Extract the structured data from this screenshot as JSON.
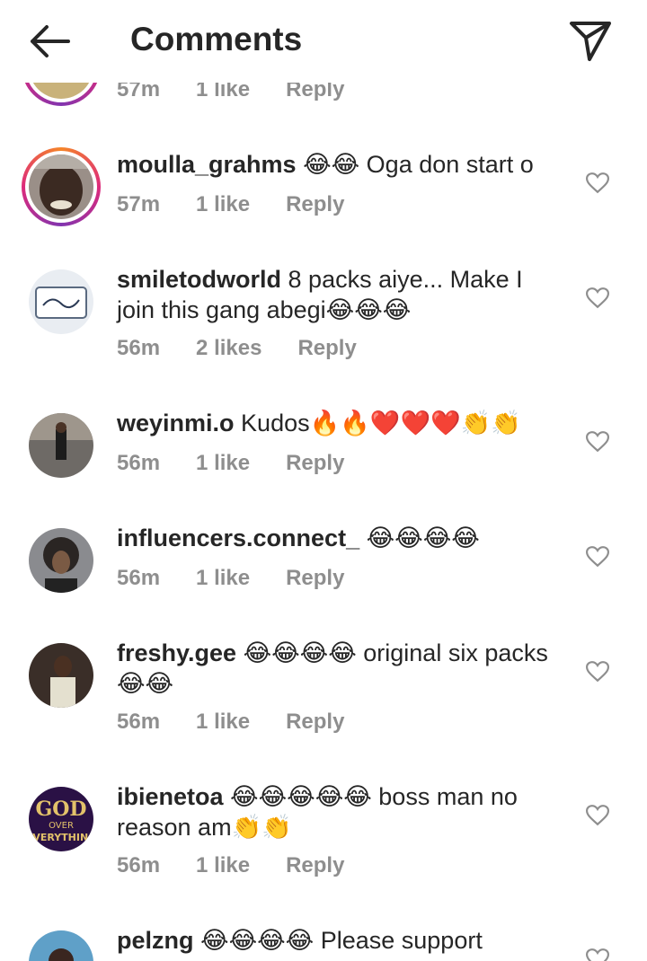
{
  "header": {
    "title": "Comments",
    "back_icon": "arrow-left-icon",
    "send_icon": "paper-plane-icon"
  },
  "partial_top": {
    "time": "57m",
    "likes": "1 like",
    "reply": "Reply"
  },
  "comments": [
    {
      "username": "moulla_grahms",
      "text": "😂😂 Oga don start o",
      "time": "57m",
      "likes": "1 like",
      "reply": "Reply"
    },
    {
      "username": "smiletodworld",
      "text": "8 packs aiye... Make I join this gang abegi😂😂😂",
      "time": "56m",
      "likes": "2 likes",
      "reply": "Reply"
    },
    {
      "username": "weyinmi.o",
      "text": "Kudos🔥🔥❤️❤️❤️👏👏",
      "time": "56m",
      "likes": "1 like",
      "reply": "Reply"
    },
    {
      "username": "influencers.connect_",
      "text": "😂😂😂😂",
      "time": "56m",
      "likes": "1 like",
      "reply": "Reply"
    },
    {
      "username": "freshy.gee",
      "text": "😂😂😂😂 original six packs😂😂",
      "time": "56m",
      "likes": "1 like",
      "reply": "Reply"
    },
    {
      "username": "ibienetoa",
      "text": "😂😂😂😂😂 boss man no reason am👏👏",
      "time": "56m",
      "likes": "1 like",
      "reply": "Reply"
    },
    {
      "username": "pelzng",
      "text": "😂😂😂😂 Please support",
      "time": "",
      "likes": "",
      "reply": ""
    }
  ],
  "avatar_text": {
    "ibienetoa_line1": "GOD",
    "ibienetoa_line2": "OVER",
    "ibienetoa_line3": "EVERYTHING"
  },
  "colors": {
    "meta": "#8e8e8e",
    "text": "#262626",
    "ring_start": "#f58529",
    "ring_end": "#dd2a7b"
  }
}
